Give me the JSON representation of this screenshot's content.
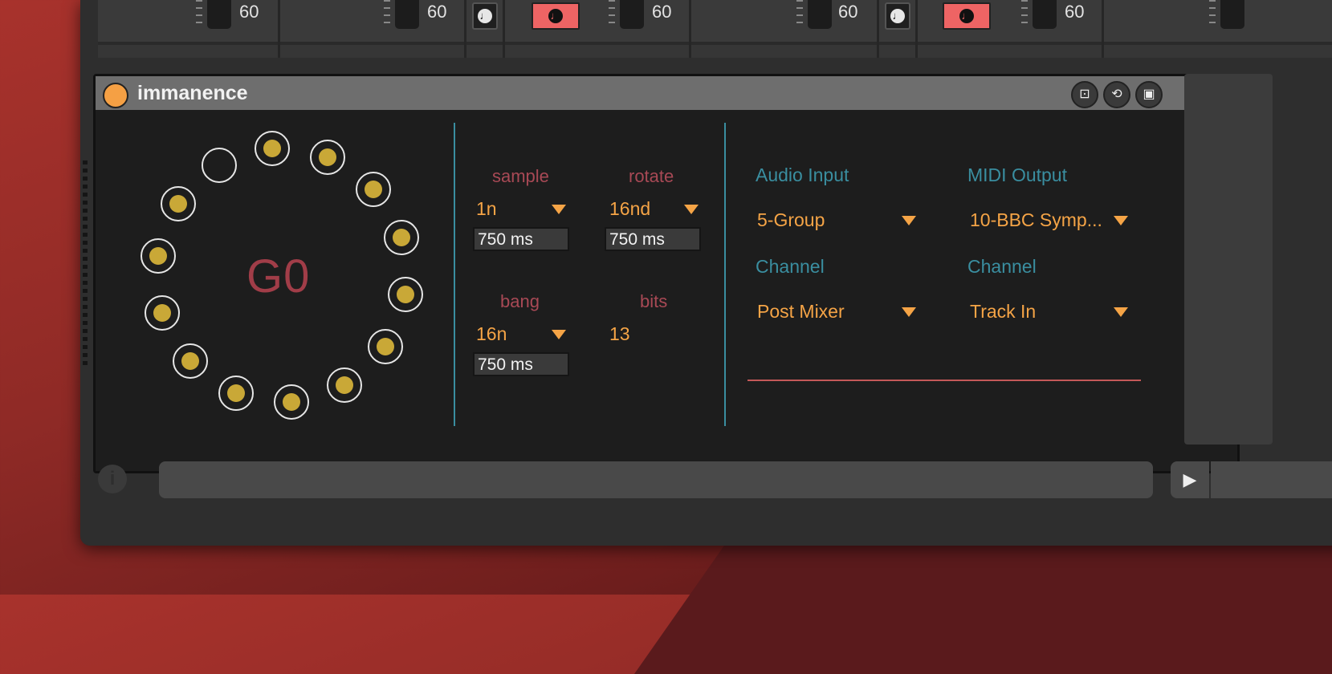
{
  "mixer": {
    "fader_values": [
      "60",
      "60",
      "60",
      "60",
      "60"
    ],
    "clock_icon": "clock-icon"
  },
  "device": {
    "title": "immanence",
    "note": "G0",
    "params": {
      "sample": {
        "label": "sample",
        "value": "1n",
        "time": "750 ms"
      },
      "rotate": {
        "label": "rotate",
        "value": "16nd",
        "time": "750 ms"
      },
      "bang": {
        "label": "bang",
        "value": "16n",
        "time": "750 ms"
      },
      "bits": {
        "label": "bits",
        "value": "13"
      }
    },
    "routing": {
      "audio_input_label": "Audio Input",
      "audio_input_value": "5-Group",
      "audio_channel_label": "Channel",
      "audio_channel_value": "Post Mixer",
      "midi_output_label": "MIDI Output",
      "midi_output_value": "10-BBC Symp...",
      "midi_channel_label": "Channel",
      "midi_channel_value": "Track In"
    },
    "ring": {
      "total": 14,
      "active": 13
    },
    "colors": {
      "accent": "#f5a446",
      "label_red": "#a84955",
      "label_blue": "#3a8ea0",
      "dot": "#c9a837",
      "power": "#f5a044"
    }
  },
  "transport": {
    "info_icon": "i",
    "play_icon": "▶"
  }
}
